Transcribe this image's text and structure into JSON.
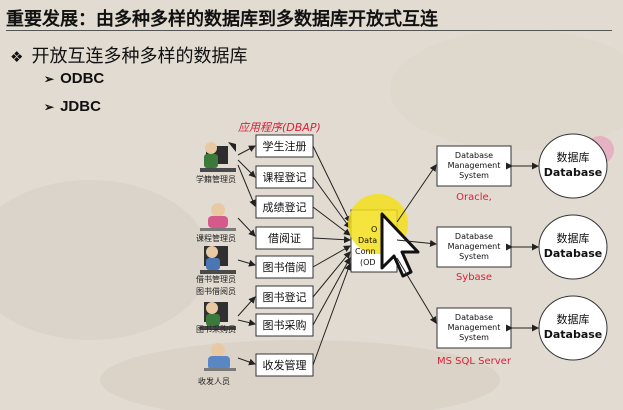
{
  "slide": {
    "title": "重要发展：由多种多样的数据库到多数据库开放式互连",
    "bullet": "开放互连多种多样的数据库",
    "sub_items": [
      "ODBC",
      "JDBC"
    ]
  },
  "diagram": {
    "app_label": "应用程序(DBAP)",
    "apps": [
      "学生注册",
      "课程登记",
      "成绩登记",
      "借阅证",
      "图书借阅",
      "图书登记",
      "图书采购",
      "收发管理"
    ],
    "people": [
      "学籍管理员",
      "课程管理员",
      "借书管理员",
      "图书借阅员",
      "图书采购员",
      "收发人员"
    ],
    "odbc_lines": [
      "O",
      "Data",
      "Conn",
      "(OD"
    ],
    "dbms": [
      {
        "lines": [
          "Database",
          "Management",
          "System"
        ],
        "vendor": "Oracle,"
      },
      {
        "lines": [
          "Database",
          "Management",
          "System"
        ],
        "vendor": "Sybase"
      },
      {
        "lines": [
          "Database",
          "Management",
          "System"
        ],
        "vendor": "MS SQL Server"
      }
    ],
    "db": {
      "cn": "数据库",
      "en": "Database"
    },
    "colors": {
      "app_label": "#d8203a",
      "vendor": "#d8203a",
      "highlight": "#f3df1c",
      "box_border": "#333333"
    }
  }
}
